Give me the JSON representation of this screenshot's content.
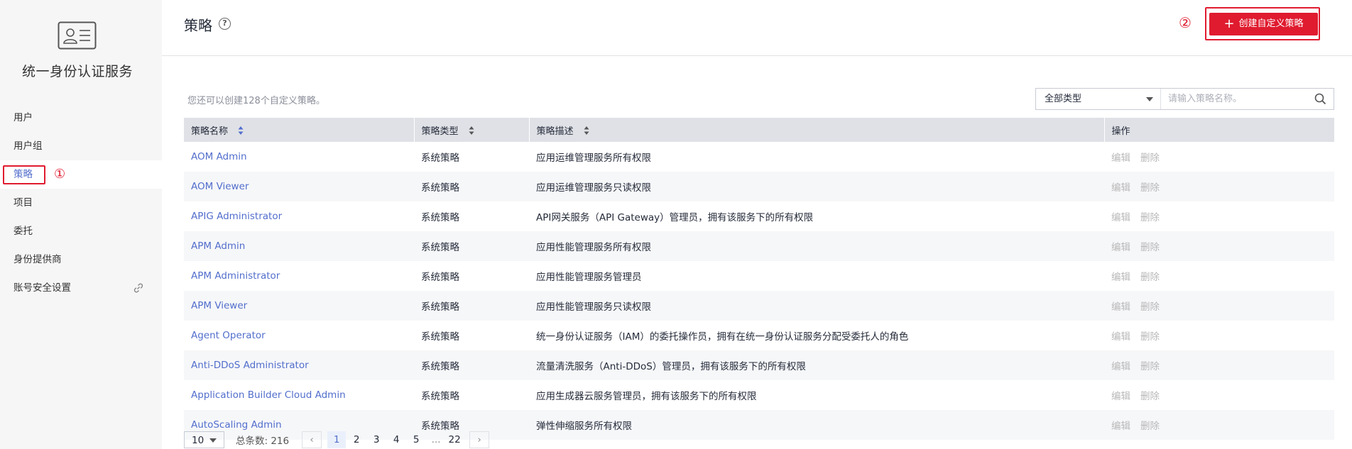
{
  "sidebar": {
    "title": "统一身份认证服务",
    "items": [
      {
        "label": "用户"
      },
      {
        "label": "用户组"
      },
      {
        "label": "策略",
        "active": true,
        "marker": "①"
      },
      {
        "label": "项目"
      },
      {
        "label": "委托"
      },
      {
        "label": "身份提供商"
      },
      {
        "label": "账号安全设置",
        "icon": "link-icon"
      }
    ]
  },
  "header": {
    "title": "策略",
    "help_icon": "?",
    "marker": "②",
    "create_label": "创建自定义策略"
  },
  "content": {
    "quota_text": "您还可以创建128个自定义策略。",
    "filter": {
      "type_value": "全部类型",
      "search_placeholder": "请输入策略名称。"
    },
    "columns": [
      "策略名称",
      "策略类型",
      "策略描述",
      "操作"
    ],
    "rows": [
      {
        "name": "AOM Admin",
        "type": "系统策略",
        "desc": "应用运维管理服务所有权限",
        "edit": "编辑",
        "delete": "删除"
      },
      {
        "name": "AOM Viewer",
        "type": "系统策略",
        "desc": "应用运维管理服务只读权限",
        "edit": "编辑",
        "delete": "删除"
      },
      {
        "name": "APIG Administrator",
        "type": "系统策略",
        "desc": "API网关服务（API Gateway）管理员，拥有该服务下的所有权限",
        "edit": "编辑",
        "delete": "删除"
      },
      {
        "name": "APM Admin",
        "type": "系统策略",
        "desc": "应用性能管理服务所有权限",
        "edit": "编辑",
        "delete": "删除"
      },
      {
        "name": "APM Administrator",
        "type": "系统策略",
        "desc": "应用性能管理服务管理员",
        "edit": "编辑",
        "delete": "删除"
      },
      {
        "name": "APM Viewer",
        "type": "系统策略",
        "desc": "应用性能管理服务只读权限",
        "edit": "编辑",
        "delete": "删除"
      },
      {
        "name": "Agent Operator",
        "type": "系统策略",
        "desc": "统一身份认证服务（IAM）的委托操作员，拥有在统一身份认证服务分配受委托人的角色",
        "edit": "编辑",
        "delete": "删除"
      },
      {
        "name": "Anti-DDoS Administrator",
        "type": "系统策略",
        "desc": "流量清洗服务（Anti-DDoS）管理员，拥有该服务下的所有权限",
        "edit": "编辑",
        "delete": "删除"
      },
      {
        "name": "Application Builder Cloud Admin",
        "type": "系统策略",
        "desc": "应用生成器云服务管理员，拥有该服务下的所有权限",
        "edit": "编辑",
        "delete": "删除"
      },
      {
        "name": "AutoScaling Admin",
        "type": "系统策略",
        "desc": "弹性伸缩服务所有权限",
        "edit": "编辑",
        "delete": "删除"
      }
    ]
  },
  "pagination": {
    "page_size": "10",
    "total": "总条数: 216",
    "pages": [
      "1",
      "2",
      "3",
      "4",
      "5",
      "...",
      "22"
    ],
    "current": "1"
  },
  "colors": {
    "accent": "#526ecc",
    "danger": "#e01b2f",
    "sidebar_bg": "#f6f6f6"
  }
}
